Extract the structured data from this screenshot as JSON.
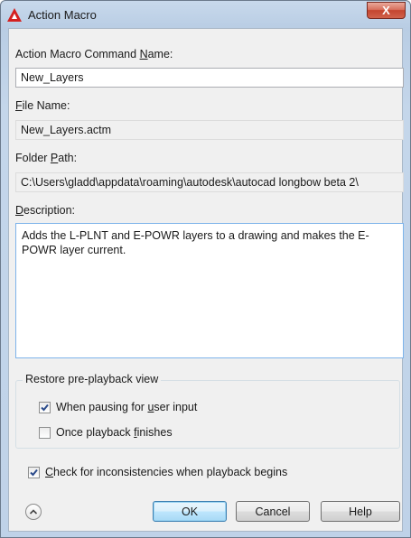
{
  "window": {
    "title": "Action Macro",
    "close_symbol": "X",
    "app_icon": "autocad-icon"
  },
  "fields": {
    "command_name": {
      "label_pre": "Action Macro Command ",
      "label_key": "N",
      "label_post": "ame:",
      "value": "New_Layers"
    },
    "file_name": {
      "label_pre": "",
      "label_key": "F",
      "label_post": "ile Name:",
      "value": "New_Layers.actm"
    },
    "folder_path": {
      "label_pre": "Folder ",
      "label_key": "P",
      "label_post": "ath:",
      "value": "C:\\Users\\gladd\\appdata\\roaming\\autodesk\\autocad longbow beta 2\\"
    },
    "description": {
      "label_pre": "",
      "label_key": "D",
      "label_post": "escription:",
      "value": "Adds the L-PLNT and E-POWR layers to a drawing and makes the E-POWR layer current."
    }
  },
  "restore_group": {
    "title": "Restore pre-playback view",
    "when_pausing": {
      "label_pre": "When pausing for ",
      "label_key": "u",
      "label_post": "ser input",
      "checked": true
    },
    "once_finishes": {
      "label_pre": "Once playback ",
      "label_key": "f",
      "label_post": "inishes",
      "checked": false
    }
  },
  "check_inconsistencies": {
    "label_pre": "",
    "label_key": "C",
    "label_post": "heck for inconsistencies when playback begins",
    "checked": true
  },
  "buttons": {
    "ok": "OK",
    "cancel": "Cancel",
    "help": "Help"
  },
  "colors": {
    "title_bar": "#bfd2e8",
    "close_button": "#c4452f",
    "dialog_bg": "#f0f0f0",
    "focus_border": "#7eb4ea",
    "check_mark": "#2a4a8a"
  }
}
